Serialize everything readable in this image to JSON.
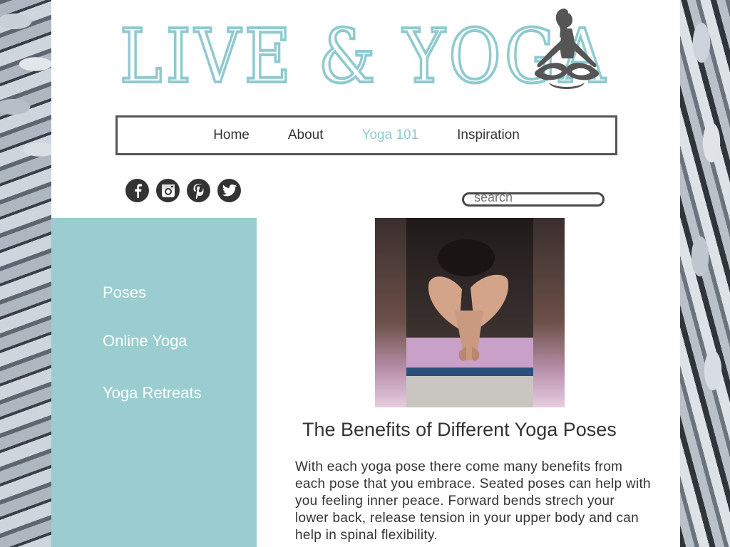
{
  "site": {
    "logo_text": "LIVE & YOGA",
    "logo_icon": "meditating-woman-icon",
    "accent_color": "#8fcad0",
    "sidebar_color": "#9acdd0",
    "dark_color": "#333333"
  },
  "nav": {
    "items": [
      {
        "label": "Home",
        "active": false
      },
      {
        "label": "About",
        "active": false
      },
      {
        "label": "Yoga 101",
        "active": true
      },
      {
        "label": "Inspiration",
        "active": false
      }
    ]
  },
  "social": [
    "facebook-icon",
    "instagram-icon",
    "pinterest-icon",
    "twitter-icon"
  ],
  "search": {
    "placeholder": "search"
  },
  "sidebar": {
    "items": [
      {
        "label": "Poses"
      },
      {
        "label": "Online Yoga"
      },
      {
        "label": "Yoga Retreats"
      }
    ]
  },
  "article": {
    "image_description_icon": "yoga-forward-bend-photo",
    "title": "The Benefits of Different Yoga Poses",
    "body": "With each yoga pose there come many benefits from each pose that you embrace. Seated poses can help with you feeling inner peace. Forward bends strech your lower back, release tension in your upper body and can help in spinal flexibility."
  }
}
